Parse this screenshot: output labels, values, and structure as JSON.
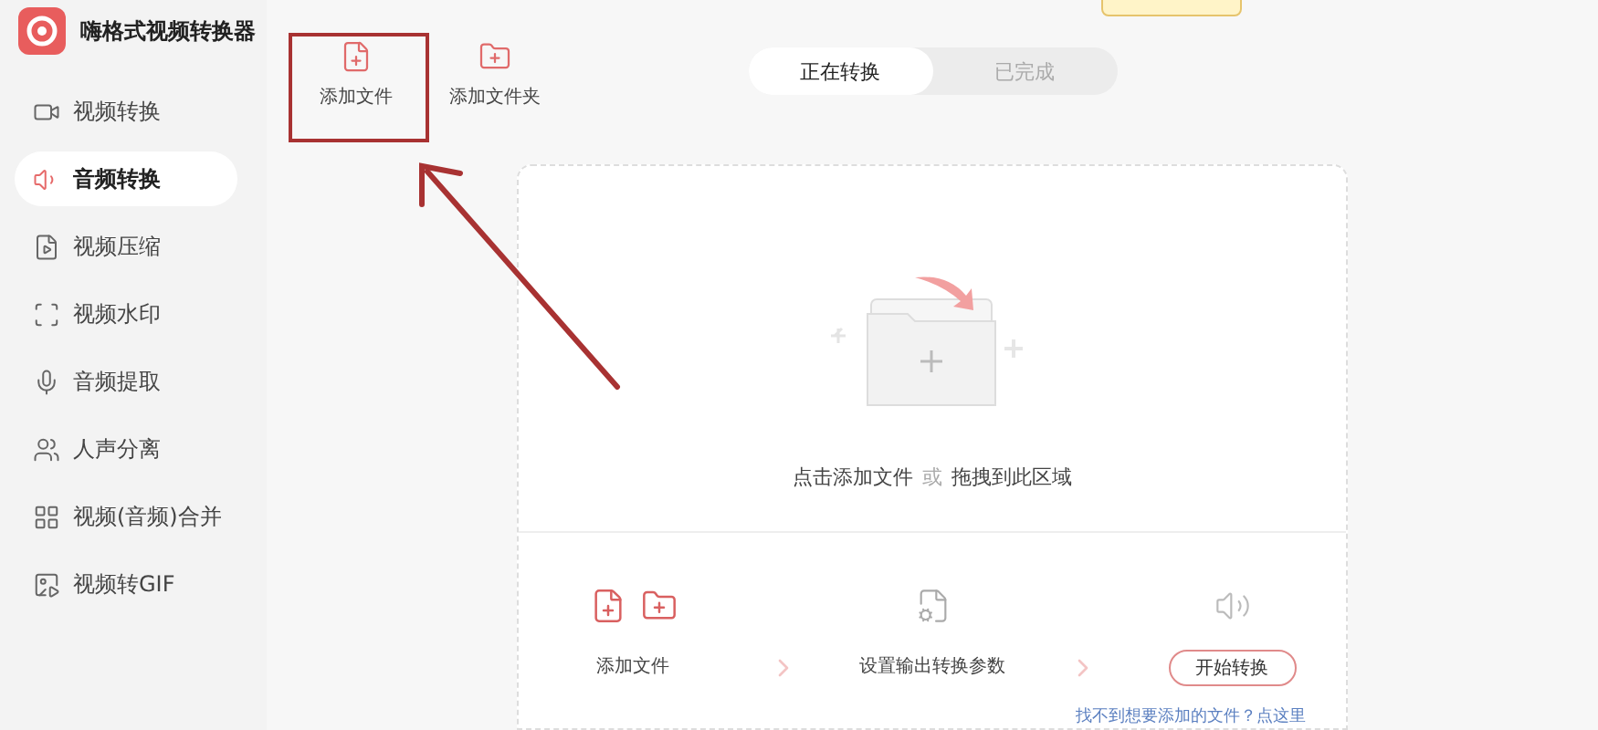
{
  "app": {
    "title": "嗨格式视频转换器"
  },
  "sidebar": {
    "items": [
      {
        "label": "视频转换",
        "selected": false
      },
      {
        "label": "音频转换",
        "selected": true
      },
      {
        "label": "视频压缩",
        "selected": false
      },
      {
        "label": "视频水印",
        "selected": false
      },
      {
        "label": "音频提取",
        "selected": false
      },
      {
        "label": "人声分离",
        "selected": false
      },
      {
        "label": "视频(音频)合并",
        "selected": false
      },
      {
        "label": "视频转GIF",
        "selected": false
      }
    ]
  },
  "toolbar": {
    "buttons": [
      {
        "label": "添加文件",
        "kind": "file"
      },
      {
        "label": "添加文件夹",
        "kind": "folder"
      }
    ]
  },
  "tabs": [
    {
      "label": "正在转换",
      "selected": true
    },
    {
      "label": "已完成",
      "selected": false
    }
  ],
  "drop_zone": {
    "prompt": "点击添加文件",
    "or": "或",
    "drag": "拖拽到此区域"
  },
  "steps": [
    {
      "kind": "add",
      "label": "添加文件"
    },
    {
      "kind": "settings",
      "label": "设置输出转换参数"
    },
    {
      "kind": "start",
      "label": "开始转换"
    }
  ],
  "help_link": "找不到想要添加的文件？点这里"
}
